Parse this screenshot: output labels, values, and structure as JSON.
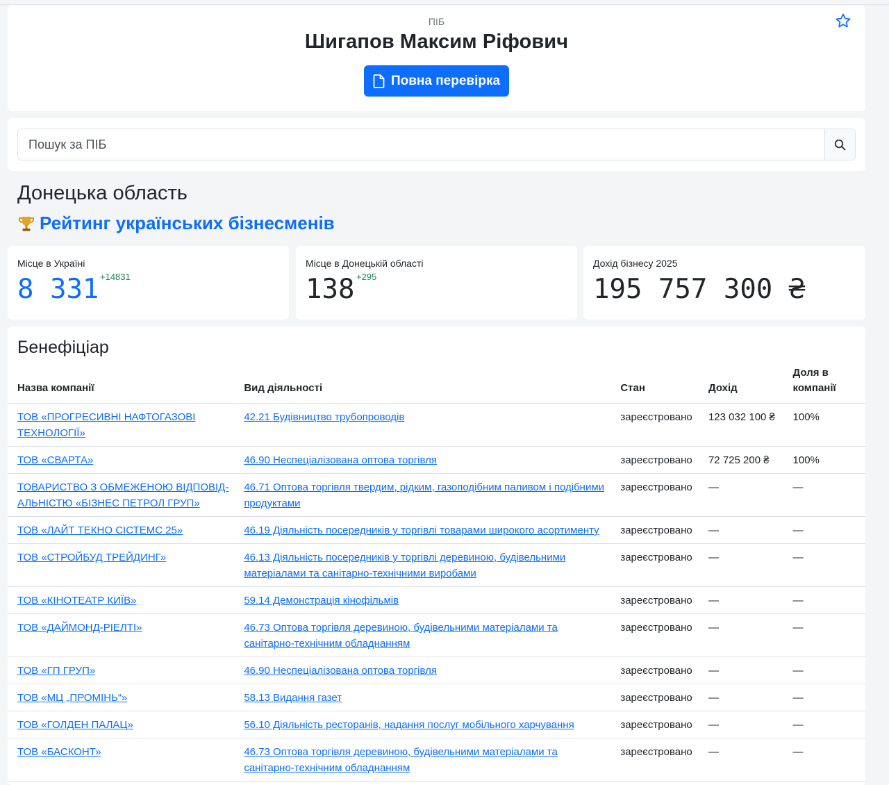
{
  "header": {
    "label": "ПІБ",
    "name": "Шигапов Максим Ріфович",
    "full_check_label": "Повна перевірка"
  },
  "icons": {
    "favorite": "star-outline-icon",
    "document": "file-icon",
    "search": "search-icon",
    "trophy": "trophy-icon"
  },
  "search": {
    "placeholder": "Пошук за ПІБ"
  },
  "region": {
    "title": "Донецька область"
  },
  "rating": {
    "label": "Рейтинг українських бізнесменів"
  },
  "stats": [
    {
      "label": "Місце в Україні",
      "value": "8 331",
      "delta": "+14831"
    },
    {
      "label": "Місце в Донецькій області",
      "value": "138",
      "delta": "+295"
    },
    {
      "label": "Дохід бізнесу 2025",
      "value": "195 757 300 ₴"
    }
  ],
  "beneficiary": {
    "title": "Бенефіціар",
    "columns": [
      "Назва компанії",
      "Вид діяльності",
      "Стан",
      "Дохід",
      "Доля в компанії"
    ],
    "rows": [
      {
        "company": "ТОВ «ПРОГРЕСИВНІ НАФТОГАЗОВІ ТЕХНОЛОГІЇ»",
        "activity": "42.21 Будівництво трубопроводів",
        "status": "зареєстровано",
        "income": "123 032 100 ₴",
        "share": "100%"
      },
      {
        "company": "ТОВ «СВАРТА»",
        "activity": "46.90 Неспеціалізована оптова торгівля",
        "status": "зареєстровано",
        "income": "72 725 200 ₴",
        "share": "100%"
      },
      {
        "company": "ТОВАРИСТВО З ОБМЕЖЕНОЮ ВІДПОВІД-АЛЬНІСТЮ «БІЗНЕС ПЕТРОЛ ГРУП»",
        "activity": "46.71 Оптова торгівля твердим, рідким, газоподібним паливом і подібними продуктами",
        "status": "зареєстровано",
        "income": "—",
        "share": "—"
      },
      {
        "company": "ТОВ «ЛАЙТ ТЕКНО СІСТЕМС 25»",
        "activity": "46.19 Діяльність посередників у торгівлі товарами широкого асортименту",
        "status": "зареєстровано",
        "income": "—",
        "share": "—"
      },
      {
        "company": "ТОВ «СТРОЙБУД ТРЕЙДИНГ»",
        "activity": "46.13 Діяльність посередників у торгівлі деревиною, будівельними матеріалами та санітарно-технічними виробами",
        "status": "зареєстровано",
        "income": "—",
        "share": "—"
      },
      {
        "company": "ТОВ «КІНОТЕАТР КИЇВ»",
        "activity": "59.14 Демонстрація кінофільмів",
        "status": "зареєстровано",
        "income": "—",
        "share": "—"
      },
      {
        "company": "ТОВ «ДАЙМОНД-РІЕЛТІ»",
        "activity": "46.73 Оптова торгівля деревиною, будівельними матеріалами та санітарно-технічним обладнанням",
        "status": "зареєстровано",
        "income": "—",
        "share": "—"
      },
      {
        "company": "ТОВ «ГП ГРУП»",
        "activity": "46.90 Неспеціалізована оптова торгівля",
        "status": "зареєстровано",
        "income": "—",
        "share": "—"
      },
      {
        "company": "ТОВ «МЦ „ПРОМІНЬ“»",
        "activity": "58.13 Видання газет",
        "status": "зареєстровано",
        "income": "—",
        "share": "—"
      },
      {
        "company": "ТОВ «ГОЛДЕН ПАЛАЦ»",
        "activity": "56.10 Діяльність ресторанів, надання послуг мобільного харчування",
        "status": "зареєстровано",
        "income": "—",
        "share": "—"
      },
      {
        "company": "ТОВ «БАСКОНТ»",
        "activity": "46.73 Оптова торгівля деревиною, будівельними матеріалами та санітарно-технічним обладнанням",
        "status": "зареєстровано",
        "income": "—",
        "share": "—"
      }
    ]
  }
}
